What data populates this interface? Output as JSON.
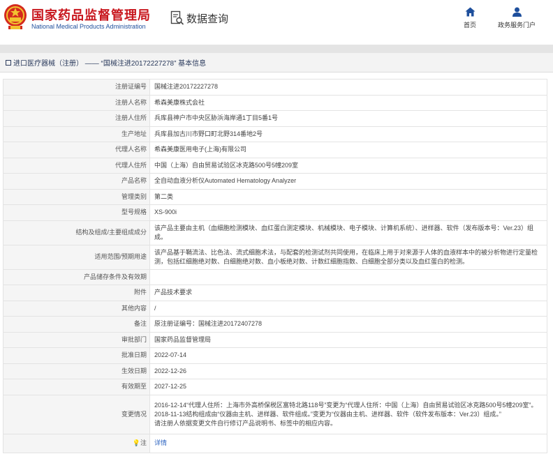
{
  "header": {
    "org_name_cn": "国家药品监督管理局",
    "org_name_en": "National Medical Products Administration",
    "query_label": "数据查询",
    "nav": {
      "home": "首页",
      "gov_portal": "政务服务门户"
    }
  },
  "breadcrumb": {
    "text": "进口医疗器械（注册） —— “国械注进20172227278” 基本信息"
  },
  "rows": {
    "reg_no": {
      "label": "注册证编号",
      "value": "国械注进20172227278"
    },
    "registrant": {
      "label": "注册人名称",
      "value": "希森美康株式会社"
    },
    "registrant_addr": {
      "label": "注册人住所",
      "value": "兵库县神户市中央区胁浜海岸通1丁目5番1号"
    },
    "production_addr": {
      "label": "生产地址",
      "value": "兵库县加古川市野口町北野314番地2号"
    },
    "agent": {
      "label": "代理人名称",
      "value": "希森美康医用电子(上海)有限公司"
    },
    "agent_addr": {
      "label": "代理人住所",
      "value": "中国（上海）自由贸易试验区冰克路500号5幢209室"
    },
    "product_name": {
      "label": "产品名称",
      "value": "全自动血液分析仪Automated Hematology Analyzer"
    },
    "mgmt_class": {
      "label": "管理类别",
      "value": "第二类"
    },
    "model": {
      "label": "型号规格",
      "value": "XS-900i"
    },
    "structure": {
      "label": "结构及组成/主要组成成分",
      "value": "该产品主要由主机（血细胞检测模块、血红蛋白测定模块、机械模块、电子模块、计算机系统）、进样器、软件（发布版本号：Ver.23）组成。"
    },
    "scope": {
      "label": "适用范围/预期用途",
      "value": "该产品基于鞘流法、比色法、流式细胞术法，与配套的检测试剂共同使用，在临床上用于对来源于人体的血液样本中的被分析物进行定量检测，包括红细胞绝对数、白细胞绝对数、血小板绝对数、计数红细胞指数、白细胞全部分类以及血红蛋白的检测。"
    },
    "storage": {
      "label": "产品储存条件及有效期",
      "value": ""
    },
    "attachment": {
      "label": "附件",
      "value": "产品技术要求"
    },
    "other": {
      "label": "其他内容",
      "value": "/"
    },
    "remark": {
      "label": "备注",
      "value": "原注册证编号：国械注进20172407278"
    },
    "approval_dept": {
      "label": "审批部门",
      "value": "国家药品监督管理局"
    },
    "approval_date": {
      "label": "批准日期",
      "value": "2022-07-14"
    },
    "effective_date": {
      "label": "生效日期",
      "value": "2022-12-26"
    },
    "expiry_date": {
      "label": "有效期至",
      "value": "2027-12-25"
    },
    "change": {
      "label": "变更情况",
      "line1": "2016-12-14“代理人住所：上海市外高桥保税区富特北路118号”变更为“代理人住所：中国（上海）自由贸易试验区冰克路500号5幢209室”。 2018-11-13结构组成由“仪器由主机、进样器、软件组成。”变更为“仪器由主机、进样器、软件（软件发布版本：Ver.23）组成。”",
      "line2": "请注册人依据变更文件自行修订产品说明书、标签中的相应内容。"
    },
    "note": {
      "label": "注",
      "icon": "lightbulb-icon",
      "value": "详情"
    }
  },
  "colors": {
    "brand_red": "#c8161d",
    "brand_blue": "#1e4f9c",
    "link": "#2b63c0",
    "label_bg": "#f5f5f5"
  }
}
